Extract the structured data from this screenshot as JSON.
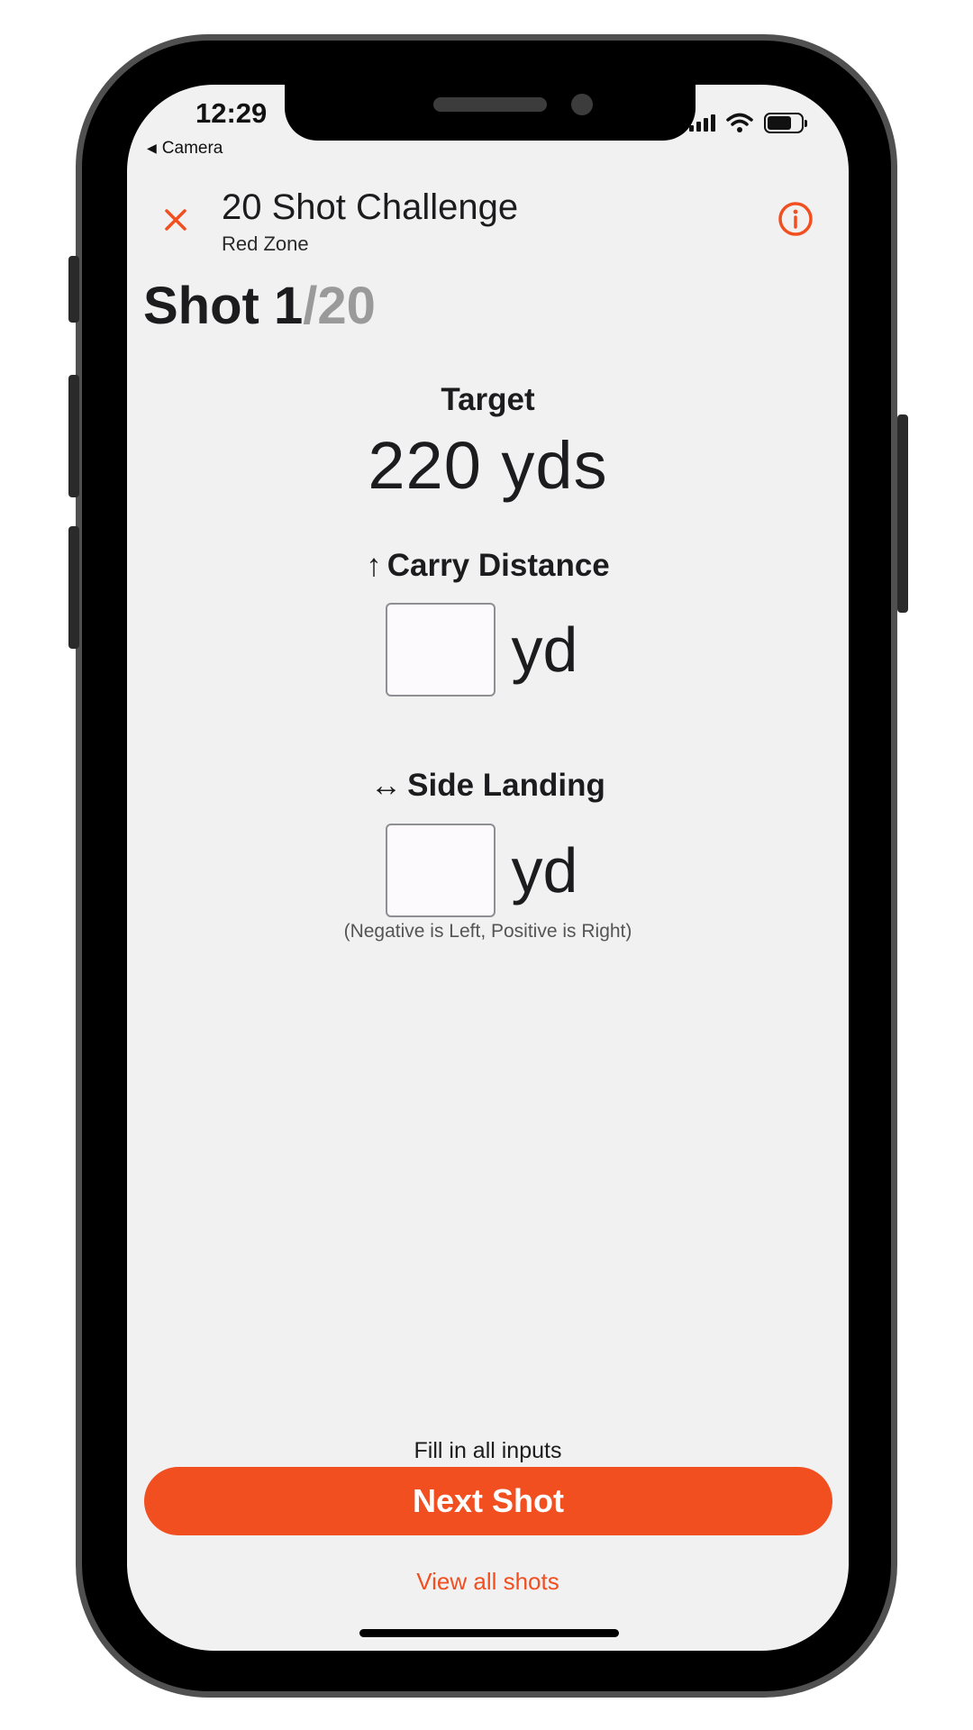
{
  "status_bar": {
    "time": "12:29",
    "back_app": "Camera"
  },
  "header": {
    "title": "20 Shot Challenge",
    "subtitle": "Red Zone",
    "close_icon": "close-x-icon",
    "info_icon": "info-circle-icon"
  },
  "shot": {
    "current": "Shot 1",
    "total": "/20"
  },
  "target": {
    "label": "Target",
    "value": "220 yds"
  },
  "carry": {
    "arrow": "↑",
    "label": "Carry Distance",
    "value": "",
    "unit": "yd"
  },
  "side": {
    "arrow": "↔",
    "label": "Side Landing",
    "value": "",
    "unit": "yd",
    "hint": "(Negative is Left, Positive is Right)"
  },
  "footer": {
    "fill_message": "Fill in all inputs",
    "next_button": "Next Shot",
    "view_all_link": "View all shots"
  },
  "colors": {
    "accent": "#f24f21",
    "background": "#f1f1f1",
    "muted_text": "#9a9a9a"
  }
}
